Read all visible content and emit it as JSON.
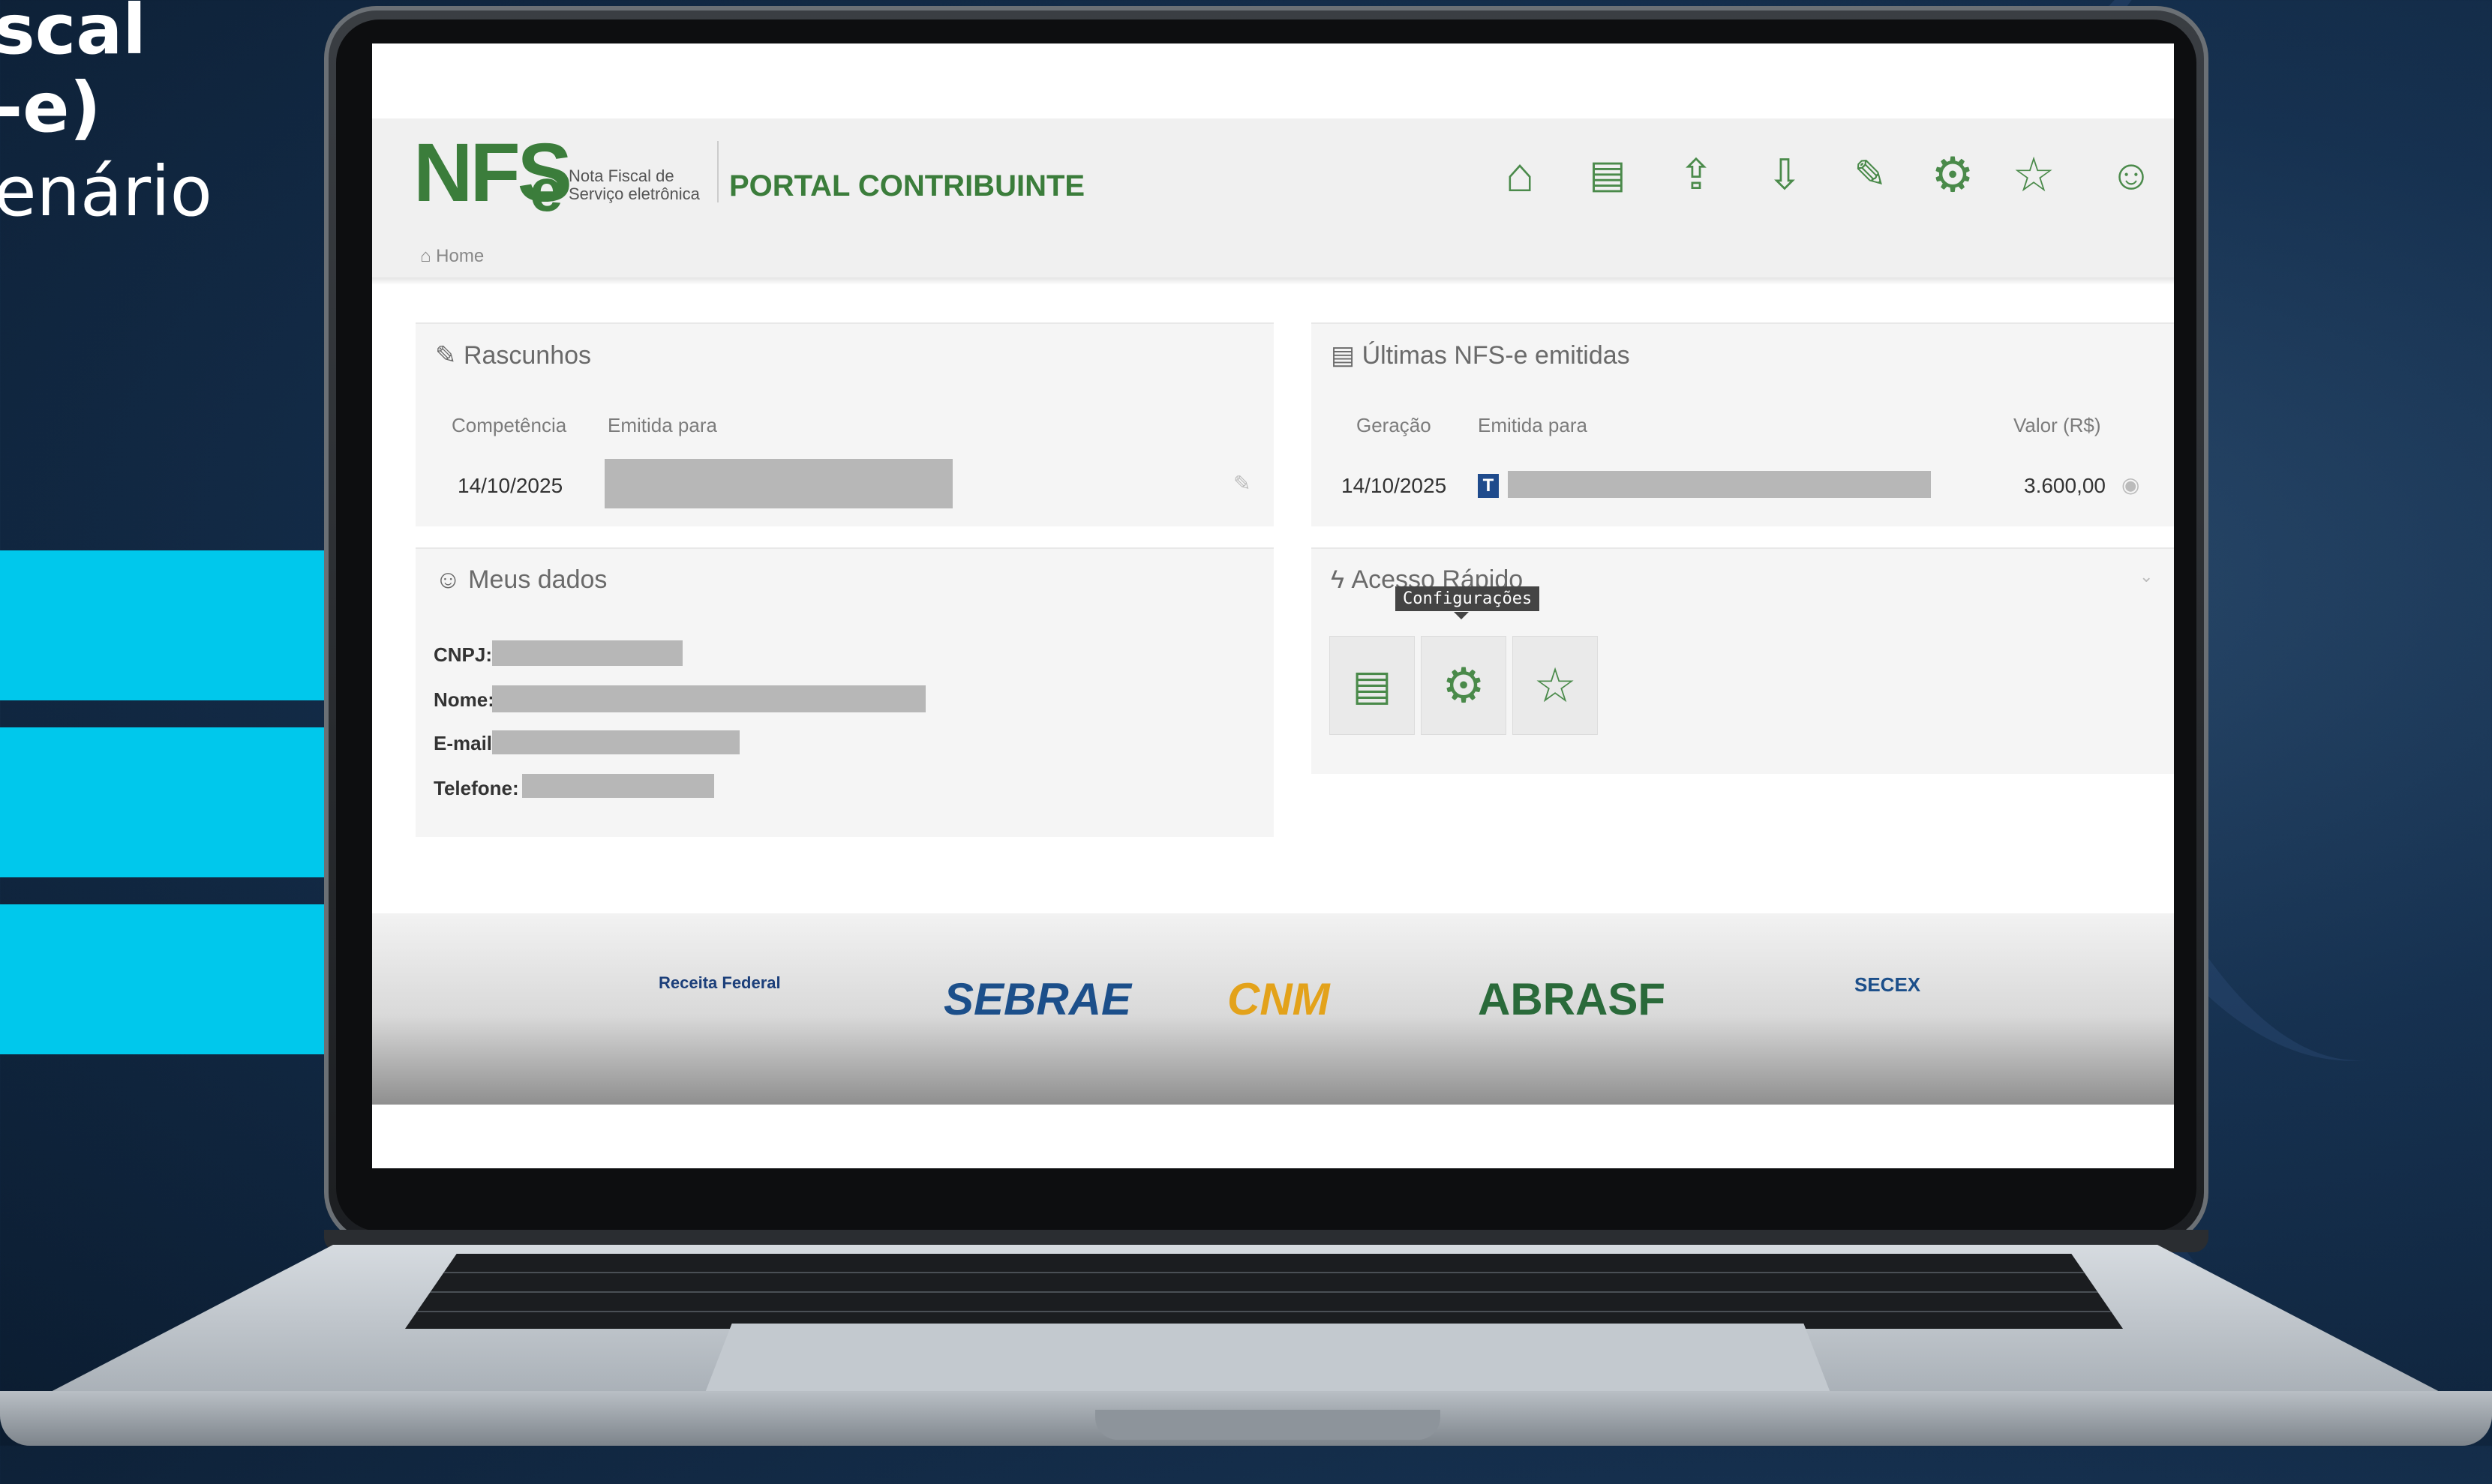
{
  "overlay": {
    "line1": "scal",
    "line2": "-e)",
    "line3": "enário"
  },
  "header": {
    "logo_text": "NFS",
    "logo_e": "e",
    "logo_sub_line1": "Nota Fiscal de",
    "logo_sub_line2": "Serviço eletrônica",
    "portal_title": "PORTAL CONTRIBUINTE",
    "breadcrumb": "Home"
  },
  "icons": [
    "home-icon",
    "emitir-nfse-icon",
    "upload-doc-icon",
    "download-doc-icon",
    "edit-doc-icon",
    "gear-icon",
    "star-icon",
    "user-icon"
  ],
  "rascunhos": {
    "title": "Rascunhos",
    "col_competencia": "Competência",
    "col_emitida": "Emitida para",
    "row_date": "14/10/2025"
  },
  "ultimas": {
    "title": "Últimas NFS-e emitidas",
    "col_geracao": "Geração",
    "col_emitida": "Emitida para",
    "col_valor": "Valor (R$)",
    "row_date": "14/10/2025",
    "row_badge": "T",
    "row_valor": "3.600,00"
  },
  "meus_dados": {
    "title": "Meus dados",
    "cnpj": "CNPJ:",
    "nome": "Nome:",
    "email": "E-mail",
    "telefone": "Telefone:"
  },
  "acesso_rapido": {
    "title": "Acesso Rápido",
    "tooltip": "Configurações"
  },
  "footer": {
    "receita": "Receita Federal",
    "sebrae": "SEBRAE",
    "cnm": "CNM",
    "abrasf": "ABRASF",
    "secex": "SECEX"
  }
}
